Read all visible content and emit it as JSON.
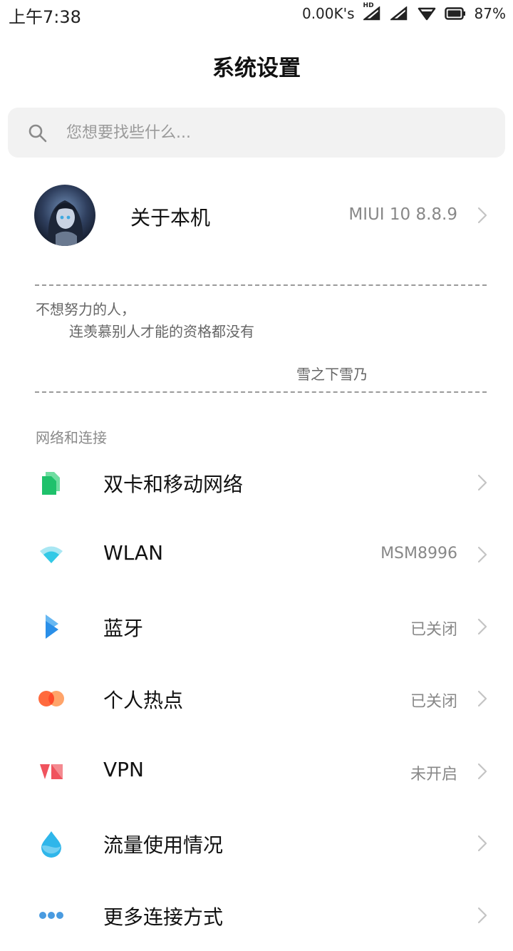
{
  "status_bar": {
    "time": "上午7:38",
    "network_speed": "0.00K's",
    "hd_tag": "HD",
    "battery": "87%",
    "icons": [
      "signal-hd-icon",
      "signal-icon",
      "wifi-icon",
      "battery-icon"
    ]
  },
  "page_title": "系统设置",
  "search": {
    "placeholder": "您想要找些什么..."
  },
  "about": {
    "label": "关于本机",
    "value": "MIUI 10 8.8.9"
  },
  "quote": {
    "line1": "不想努力的人，",
    "line2": "连羡慕别人才能的资格都没有",
    "author": "雪之下雪乃"
  },
  "section": {
    "title": "网络和连接",
    "items": [
      {
        "label": "双卡和移动网络",
        "value": "",
        "icon": "sim-card-icon",
        "color": "#1fc16b"
      },
      {
        "label": "WLAN",
        "value": "MSM8996",
        "icon": "wifi-icon",
        "color": "#33c9e6"
      },
      {
        "label": "蓝牙",
        "value": "已关闭",
        "icon": "bluetooth-icon",
        "color": "#2a8fe8"
      },
      {
        "label": "个人热点",
        "value": "已关闭",
        "icon": "hotspot-icon",
        "color": "#ff6a3d"
      },
      {
        "label": "VPN",
        "value": "未开启",
        "icon": "vpn-icon",
        "color": "#f0535e"
      },
      {
        "label": "流量使用情况",
        "value": "",
        "icon": "data-usage-icon",
        "color": "#2fb6ea"
      },
      {
        "label": "更多连接方式",
        "value": "",
        "icon": "more-connections-icon",
        "color": "#4a9be0"
      }
    ]
  }
}
